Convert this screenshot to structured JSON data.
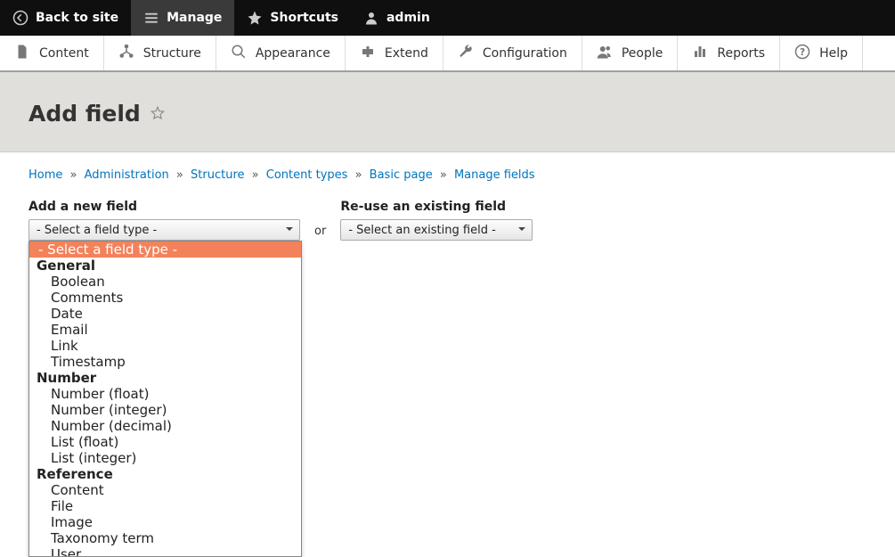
{
  "toolbar": {
    "back": "Back to site",
    "manage": "Manage",
    "shortcuts": "Shortcuts",
    "user": "admin"
  },
  "admin_menu": [
    {
      "key": "content",
      "label": "Content"
    },
    {
      "key": "structure",
      "label": "Structure"
    },
    {
      "key": "appearance",
      "label": "Appearance"
    },
    {
      "key": "extend",
      "label": "Extend"
    },
    {
      "key": "configuration",
      "label": "Configuration"
    },
    {
      "key": "people",
      "label": "People"
    },
    {
      "key": "reports",
      "label": "Reports"
    },
    {
      "key": "help",
      "label": "Help"
    }
  ],
  "page_title": "Add field",
  "breadcrumb": [
    {
      "label": "Home"
    },
    {
      "label": "Administration"
    },
    {
      "label": "Structure"
    },
    {
      "label": "Content types"
    },
    {
      "label": "Basic page"
    },
    {
      "label": "Manage fields"
    }
  ],
  "new_field": {
    "label": "Add a new field",
    "select_placeholder": "- Select a field type -"
  },
  "or_text": "or",
  "existing_field": {
    "label": "Re-use an existing field",
    "select_placeholder": "- Select an existing field -"
  },
  "dropdown": {
    "selected": "- Select a field type -",
    "groups": [
      {
        "label": "General",
        "options": [
          "Boolean",
          "Comments",
          "Date",
          "Email",
          "Link",
          "Timestamp"
        ]
      },
      {
        "label": "Number",
        "options": [
          "Number (float)",
          "Number (integer)",
          "Number (decimal)",
          "List (float)",
          "List (integer)"
        ]
      },
      {
        "label": "Reference",
        "options": [
          "Content",
          "File",
          "Image",
          "Taxonomy term",
          "User"
        ]
      }
    ]
  }
}
